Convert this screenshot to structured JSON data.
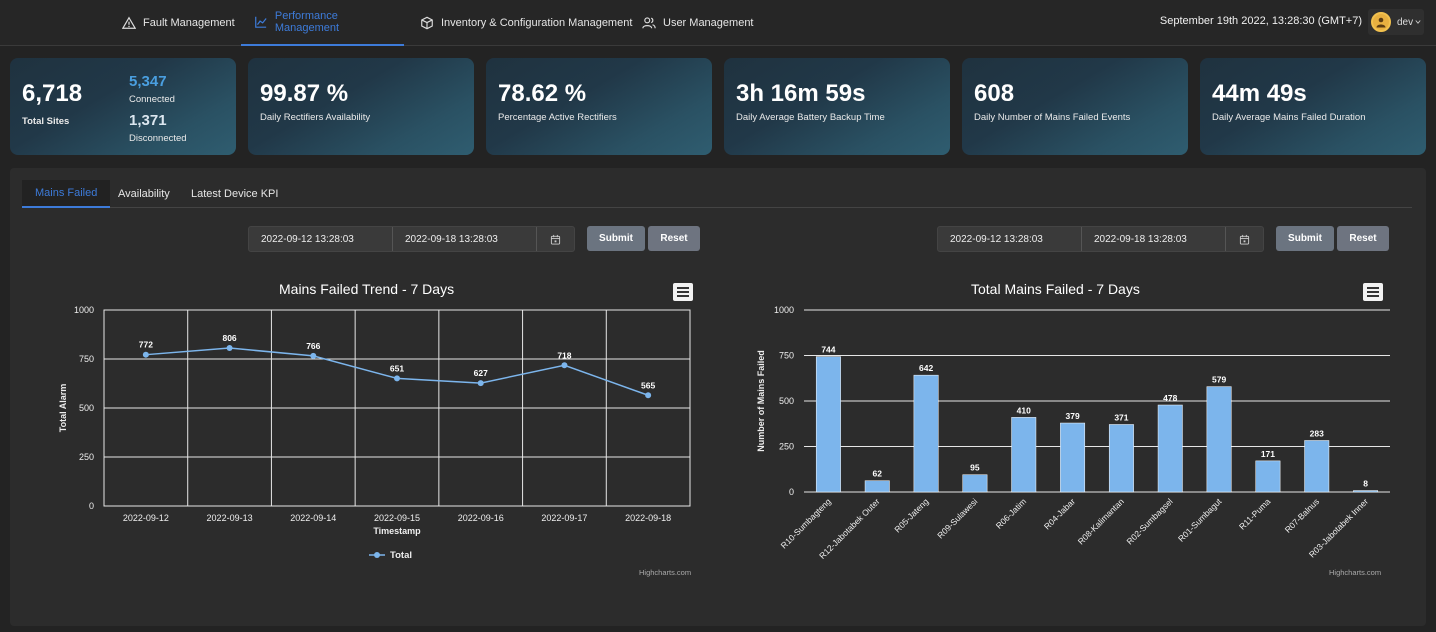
{
  "nav": {
    "items": [
      {
        "label": "Fault Management",
        "icon": "warning-icon"
      },
      {
        "label": "Performance Management",
        "icon": "chart-icon",
        "active": true
      },
      {
        "label": "Inventory & Configuration Management",
        "icon": "cube-icon"
      },
      {
        "label": "User Management",
        "icon": "users-icon"
      }
    ],
    "datetime": "September 19th 2022, 13:28:30 (GMT+7)",
    "user": "dev"
  },
  "colors": {
    "accent": "#3d7bd9",
    "connected": "#4a9fe0",
    "line": "#7cb5ec",
    "bar": "#7cb5ec"
  },
  "kpis": {
    "total_sites": {
      "value": "6,718",
      "label": "Total Sites",
      "connected_value": "5,347",
      "connected_label": "Connected",
      "disconnected_value": "1,371",
      "disconnected_label": "Disconnected"
    },
    "rectifiers_availability": {
      "value": "99.87 %",
      "label": "Daily Rectifiers Availability"
    },
    "active_rectifiers": {
      "value": "78.62 %",
      "label": "Percentage Active Rectifiers"
    },
    "battery_backup": {
      "value": "3h 16m 59s",
      "label": "Daily Average Battery Backup Time"
    },
    "mains_failed_events": {
      "value": "608",
      "label": "Daily Number of Mains Failed Events"
    },
    "mains_failed_duration": {
      "value": "44m 49s",
      "label": "Daily Average Mains Failed Duration"
    }
  },
  "tabs": [
    "Mains Failed",
    "Availability",
    "Latest Device KPI"
  ],
  "left_filter": {
    "start": "2022-09-12 13:28:03",
    "end": "2022-09-18 13:28:03",
    "submit": "Submit",
    "reset": "Reset"
  },
  "right_filter": {
    "start": "2022-09-12 13:28:03",
    "end": "2022-09-18 13:28:03",
    "submit": "Submit",
    "reset": "Reset"
  },
  "credits": "Highcharts.com",
  "chart_data": [
    {
      "type": "line",
      "title": "Mains Failed Trend - 7 Days",
      "xlabel": "Timestamp",
      "ylabel": "Total Alarm",
      "categories": [
        "2022-09-12",
        "2022-09-13",
        "2022-09-14",
        "2022-09-15",
        "2022-09-16",
        "2022-09-17",
        "2022-09-18"
      ],
      "series": [
        {
          "name": "Total",
          "values": [
            772,
            806,
            766,
            651,
            627,
            718,
            565
          ]
        }
      ],
      "ylim": [
        0,
        1000
      ],
      "yticks": [
        0,
        250,
        500,
        750,
        1000
      ],
      "grid": true,
      "legend": "bottom-center"
    },
    {
      "type": "bar",
      "title": "Total Mains Failed - 7 Days",
      "xlabel": "",
      "ylabel": "Number of Mains Failed",
      "categories": [
        "R10-Sumbagteng",
        "R12-Jabotabek Outer",
        "R05-Jateng",
        "R09-Sulawesi",
        "R06-Jatim",
        "R04-Jabar",
        "R08-Kalimantan",
        "R02-Sumbagsel",
        "R01-Sumbagut",
        "R11-Puma",
        "R07-Balnus",
        "R03-Jabotabek Inner"
      ],
      "values": [
        744,
        62,
        642,
        95,
        410,
        379,
        371,
        478,
        579,
        171,
        283,
        8
      ],
      "ylim": [
        0,
        1000
      ],
      "yticks": [
        0,
        250,
        500,
        750,
        1000
      ],
      "grid": true
    }
  ]
}
